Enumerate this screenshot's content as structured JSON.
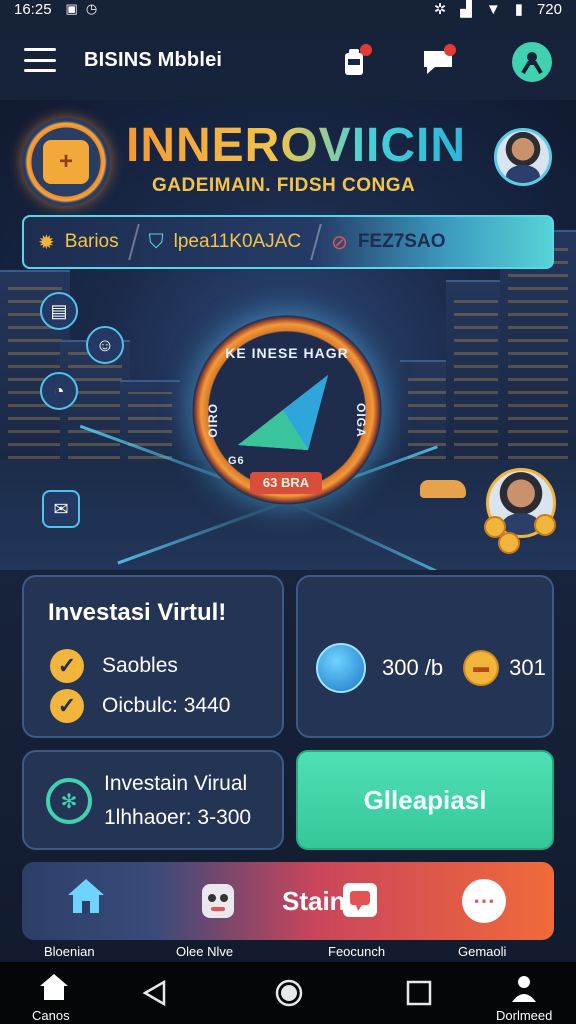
{
  "status": {
    "time": "16:25",
    "battery": "720"
  },
  "appbar": {
    "title": "BISINS Mbblei"
  },
  "hero": {
    "brand": "INNEROVIICIN",
    "tagline": "GADEIMAIN. FIDSH CONGA",
    "info": {
      "item1": "Barios",
      "item2": "lpea11K0AJAC",
      "item3": "FEZ7SAO"
    },
    "coin_top_text": "KE INESE HAGR",
    "coin_side_left": "OIRO",
    "coin_side_right": "OIGA",
    "coin_bottom_small": "G6",
    "coin_tag": "63 BRA"
  },
  "card1": {
    "title": "Investasi Virtul!",
    "row1": "Saobles",
    "row2": "Oicbulc: 3440"
  },
  "card2": {
    "stat1": "300 /b",
    "stat2": "301"
  },
  "card3": {
    "line1": "Investain Virual",
    "line2": "1lhhaoer: 3-300"
  },
  "cta": {
    "label": "Glleapiasl"
  },
  "appnav": {
    "center_label": "Stain",
    "items": [
      {
        "label": "Bloenian",
        "icon": "home-icon"
      },
      {
        "label": "Olee Nlve",
        "icon": "robot-icon"
      },
      {
        "label": "Feocunch",
        "icon": "chat-icon"
      },
      {
        "label": "Gemaoli",
        "icon": "more-icon"
      }
    ]
  },
  "sysnav": {
    "left_label": "Canos",
    "right_label": "Dorlmeed"
  },
  "colors": {
    "accent": "#3fd1b0",
    "brand_orange": "#f39a36",
    "badge": "#e53935"
  }
}
